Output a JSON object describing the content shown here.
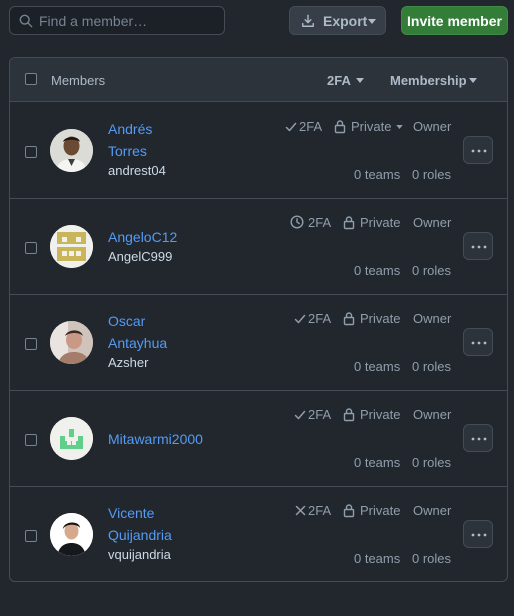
{
  "toolbar": {
    "search_placeholder": "Find a member…",
    "export_label": "Export",
    "invite_label": "Invite member"
  },
  "table_header": {
    "members_label": "Members",
    "filter_2fa_label": "2FA",
    "filter_membership_label": "Membership"
  },
  "members": [
    {
      "name_line1": "Andrés",
      "name_line2": "Torres",
      "login": "andrest04",
      "tfa_status": "enabled",
      "tfa_label": "2FA",
      "visibility": "Private",
      "visibility_has_dropdown": true,
      "role": "Owner",
      "teams": "0 teams",
      "roles": "0 roles"
    },
    {
      "name_line1": "AngeloC12",
      "name_line2": "",
      "login": "AngelC999",
      "tfa_status": "pending",
      "tfa_label": "2FA",
      "visibility": "Private",
      "visibility_has_dropdown": false,
      "role": "Owner",
      "teams": "0 teams",
      "roles": "0 roles"
    },
    {
      "name_line1": "Oscar",
      "name_line2": "Antayhua",
      "login": "Azsher",
      "tfa_status": "enabled",
      "tfa_label": "2FA",
      "visibility": "Private",
      "visibility_has_dropdown": false,
      "role": "Owner",
      "teams": "0 teams",
      "roles": "0 roles"
    },
    {
      "name_line1": "Mitawarmi2000",
      "name_line2": "",
      "login": "",
      "tfa_status": "enabled",
      "tfa_label": "2FA",
      "visibility": "Private",
      "visibility_has_dropdown": false,
      "role": "Owner",
      "teams": "0 teams",
      "roles": "0 roles"
    },
    {
      "name_line1": "Vicente",
      "name_line2": "Quijandria",
      "login": "vquijandria",
      "tfa_status": "disabled",
      "tfa_label": "2FA",
      "visibility": "Private",
      "visibility_has_dropdown": false,
      "role": "Owner",
      "teams": "0 teams",
      "roles": "0 roles"
    }
  ],
  "colors": {
    "background": "#22272e",
    "link": "#539bf5",
    "muted": "#909dab",
    "invite_button": "#347d39",
    "border": "#444c56"
  },
  "icons": {
    "search": "search-icon",
    "export": "download-icon",
    "dropdown": "triangle-down-icon",
    "tfa_enabled": "check-icon",
    "tfa_pending": "clock-icon",
    "tfa_disabled": "x-icon",
    "visibility": "lock-icon",
    "actions": "kebab-horizontal-icon"
  }
}
